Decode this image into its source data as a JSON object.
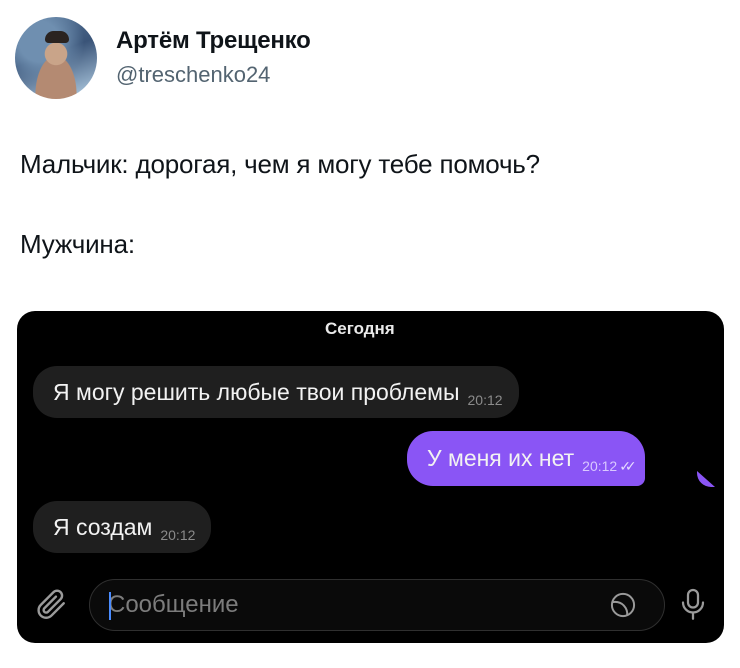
{
  "author": {
    "name": "Артём Трещенко",
    "handle": "@treschenko24",
    "avatar_icon": "profile-photo"
  },
  "tweet": {
    "line1": "Мальчик: дорогая, чем я могу тебе помочь?",
    "line2": "Мужчина:"
  },
  "chat": {
    "date_label": "Сегодня",
    "messages": [
      {
        "direction": "incoming",
        "text": "Я могу решить любые твои проблемы",
        "time": "20:12"
      },
      {
        "direction": "outgoing",
        "text": "У меня их нет",
        "time": "20:12",
        "status": "read"
      },
      {
        "direction": "incoming",
        "text": "Я создам",
        "time": "20:12"
      }
    ],
    "input_placeholder": "Сообщение",
    "icons": {
      "attach": "paperclip-icon",
      "sticker": "sticker-icon",
      "mic": "microphone-icon"
    },
    "colors": {
      "background": "#000000",
      "incoming_bubble": "#1f1f1f",
      "outgoing_bubble": "#8a55f5"
    }
  }
}
